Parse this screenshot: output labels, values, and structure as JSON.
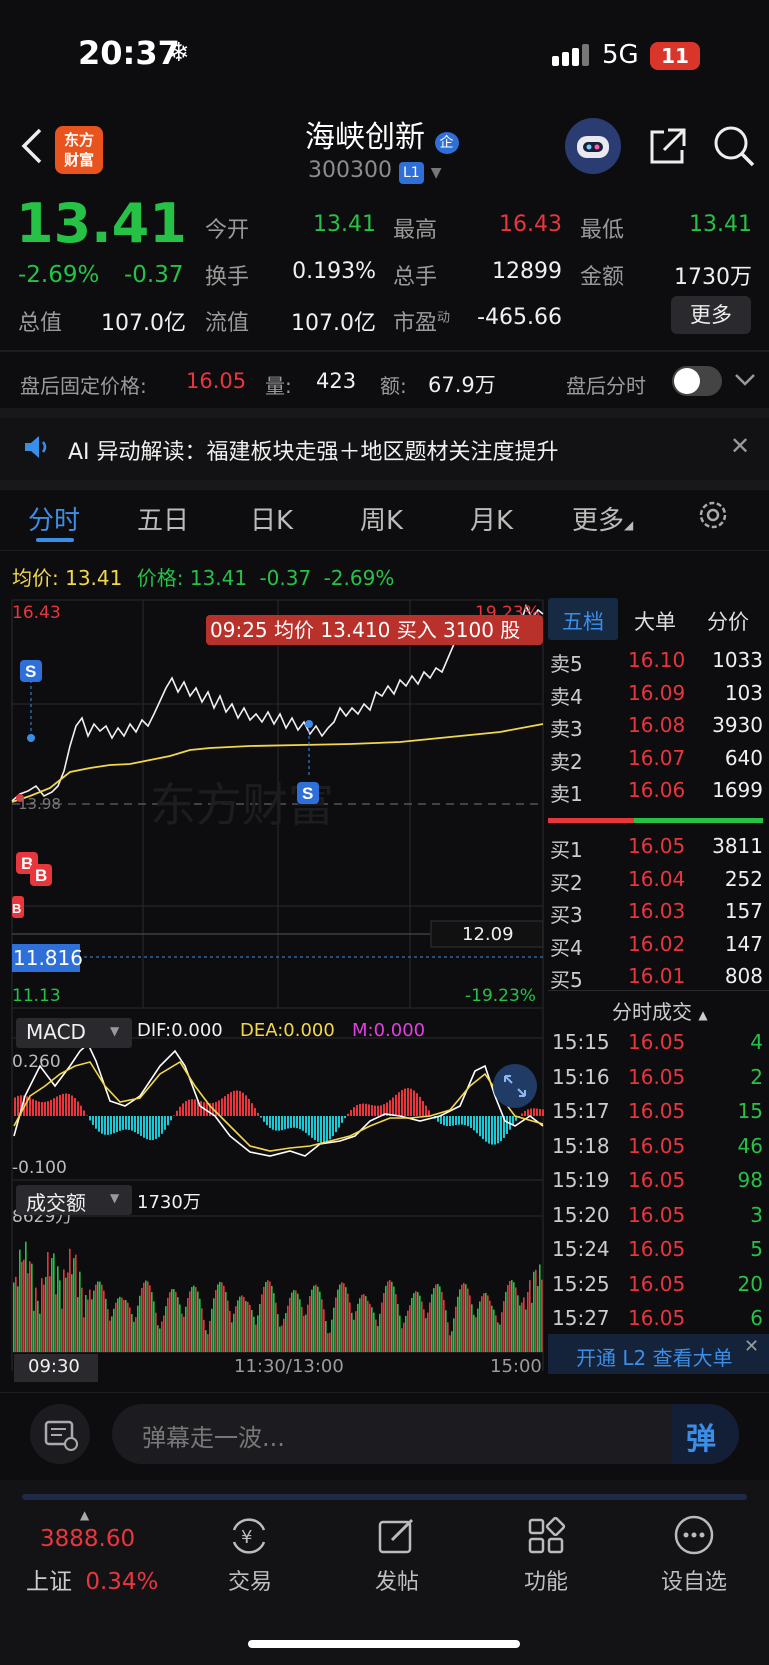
{
  "status": {
    "time": "20:37",
    "net": "5G",
    "battery": "11"
  },
  "header": {
    "logo": "东方财富",
    "name": "海峡创新",
    "name_badge": "企",
    "code": "300300",
    "level_badge": "L1"
  },
  "quote": {
    "price": "13.41",
    "change_pct": "-2.69%",
    "change": "-0.37",
    "open_label": "今开",
    "open": "13.41",
    "high_label": "最高",
    "high": "16.43",
    "low_label": "最低",
    "low": "13.41",
    "turnover_label": "换手",
    "turnover": "0.193%",
    "vol_label": "总手",
    "vol": "12899",
    "amount_label": "金额",
    "amount": "1730万",
    "mcap_label": "总值",
    "mcap": "107.0亿",
    "float_label": "流值",
    "float_cap": "107.0亿",
    "pe_label": "市盈",
    "pe_sup": "动",
    "pe": "-465.66",
    "more": "更多"
  },
  "afterhours": {
    "label": "盘后固定价格:",
    "price": "16.05",
    "vol_label": "量:",
    "vol": "423",
    "amt_label": "额:",
    "amt": "67.9万",
    "toggle_label": "盘后分时",
    "toggle_on": false
  },
  "ai_banner": {
    "text": "AI 异动解读：福建板块走强＋地区题材关注度提升"
  },
  "tabs": [
    "分时",
    "五日",
    "日K",
    "周K",
    "月K",
    "更多"
  ],
  "active_tab": 0,
  "chart": {
    "avg_label": "均价:",
    "avg": "13.41",
    "price_label": "价格:",
    "price": "13.41",
    "change": "-0.37",
    "pct": "-2.69%",
    "max_price": "16.43",
    "max_pct": "19.23%",
    "min_price": "11.13",
    "min_pct": "-19.23%",
    "ref_price": "12.09",
    "cursor_price": "11.816",
    "tooltip": "09:25 均价 13.410 买入 3100 股",
    "ref_line_label": "13.98",
    "time_start": "09:30",
    "time_mid": "11:30/13:00",
    "time_end": "15:00",
    "macd": {
      "label": "MACD",
      "dif": "DIF:0.000",
      "dea": "DEA:0.000",
      "m": "M:0.000",
      "top": "0.260",
      "bottom": "-0.100"
    },
    "vol": {
      "label": "成交额",
      "value": "1730万",
      "max": "8629万"
    },
    "watermark": "东方财富",
    "marks": [
      "S",
      "S",
      "B",
      "B",
      "B"
    ]
  },
  "orderbook": {
    "tabs": [
      "五档",
      "大单",
      "分价"
    ],
    "asks": [
      [
        "卖5",
        "16.10",
        "1033"
      ],
      [
        "卖4",
        "16.09",
        "103"
      ],
      [
        "卖3",
        "16.08",
        "3930"
      ],
      [
        "卖2",
        "16.07",
        "640"
      ],
      [
        "卖1",
        "16.06",
        "1699"
      ]
    ],
    "bids": [
      [
        "买1",
        "16.05",
        "3811"
      ],
      [
        "买2",
        "16.04",
        "252"
      ],
      [
        "买3",
        "16.03",
        "157"
      ],
      [
        "买4",
        "16.02",
        "147"
      ],
      [
        "买5",
        "16.01",
        "808"
      ]
    ]
  },
  "ticks": {
    "title": "分时成交",
    "rows": [
      [
        "15:15",
        "16.05",
        "4"
      ],
      [
        "15:16",
        "16.05",
        "2"
      ],
      [
        "15:17",
        "16.05",
        "15"
      ],
      [
        "15:18",
        "16.05",
        "46"
      ],
      [
        "15:19",
        "16.05",
        "98"
      ],
      [
        "15:20",
        "16.05",
        "3"
      ],
      [
        "15:24",
        "16.05",
        "5"
      ],
      [
        "15:25",
        "16.05",
        "20"
      ],
      [
        "15:27",
        "16.05",
        "6"
      ]
    ],
    "l2_banner": "开通 L2 查看大单"
  },
  "danmu": {
    "placeholder": "弹幕走一波...",
    "send": "弹"
  },
  "bottom_nav": {
    "index_value": "3888.60",
    "index_name": "上证",
    "index_pct": "0.34%",
    "items": [
      "交易",
      "发帖",
      "功能",
      "设自选"
    ]
  }
}
